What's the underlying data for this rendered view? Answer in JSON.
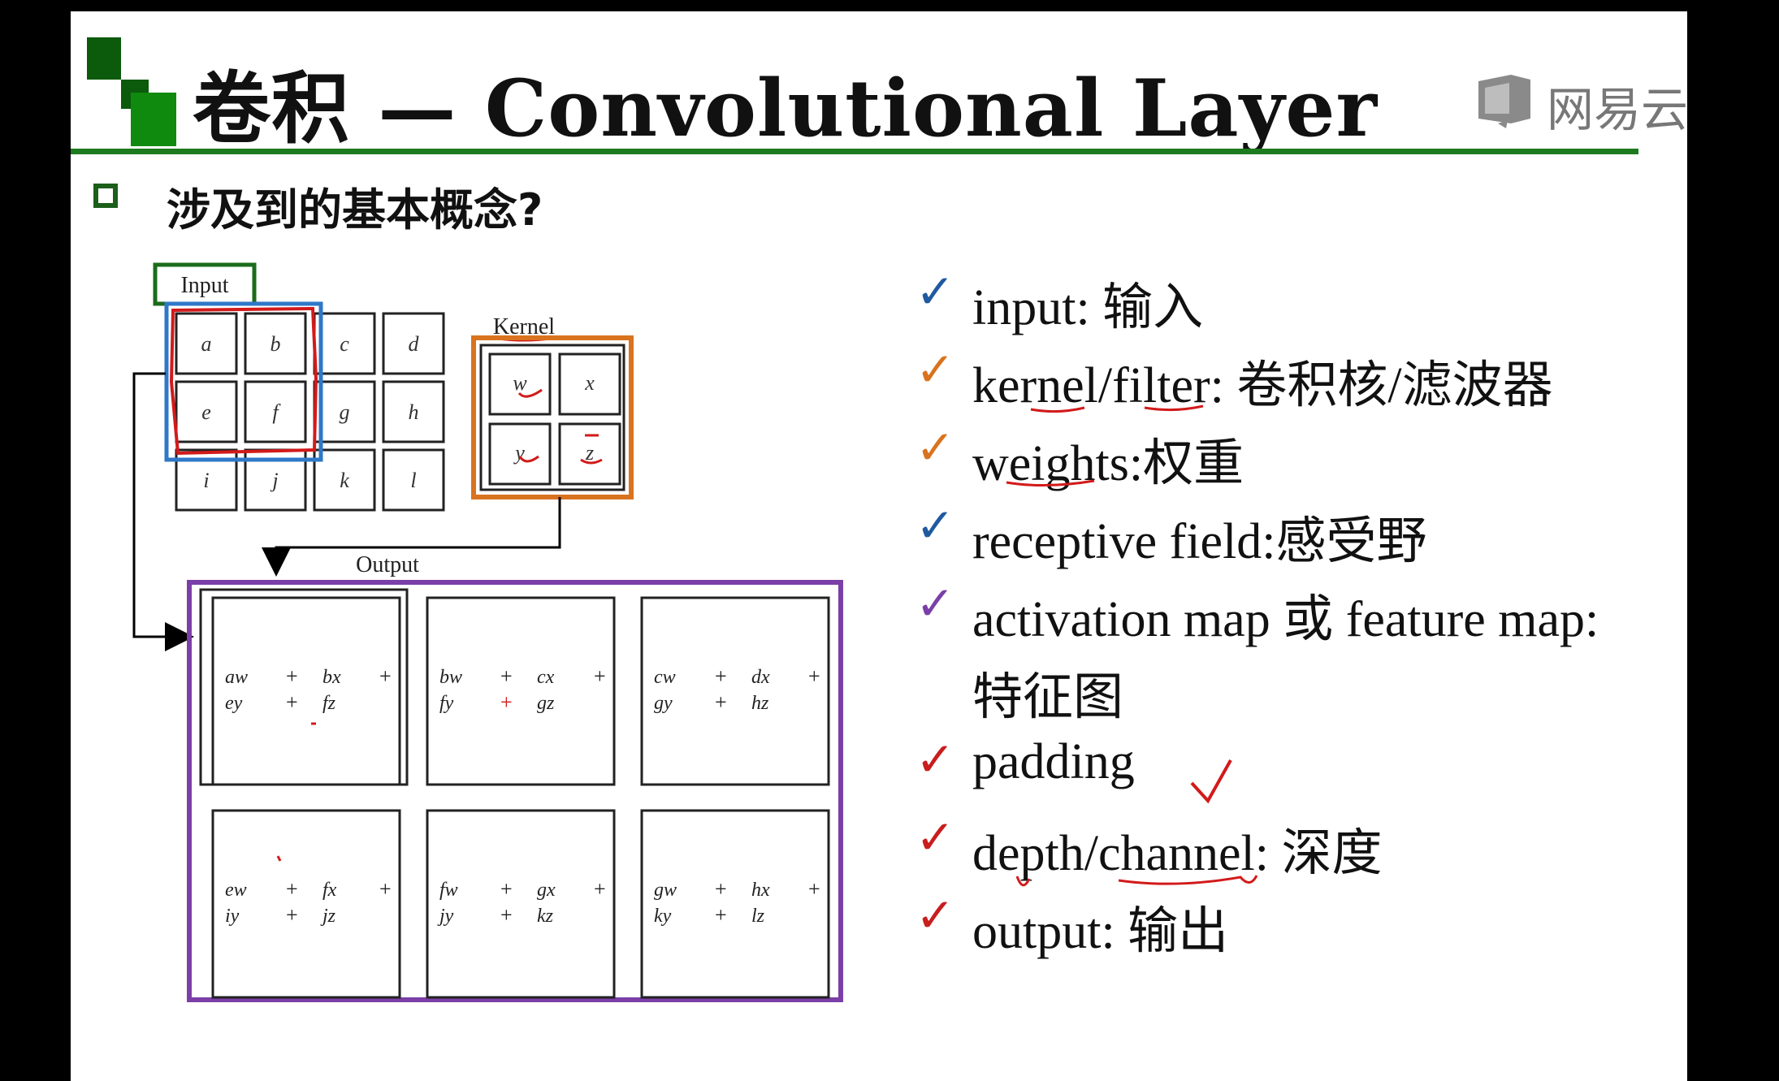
{
  "title": "卷积 — Convolutional Layer",
  "logo": {
    "text": "网易云",
    "icon": "cloud-book-icon"
  },
  "subtitle": "涉及到的基本概念?",
  "colors": {
    "green": "#1e7a1e",
    "blue": "#2f78c8",
    "red": "#d21a1a",
    "orange": "#d9731f",
    "purple": "#7b3fa8"
  },
  "diagram": {
    "input_label": "Input",
    "kernel_label": "Kernel",
    "output_label": "Output",
    "input_grid": [
      "a",
      "b",
      "c",
      "d",
      "e",
      "f",
      "g",
      "h",
      "i",
      "j",
      "k",
      "l"
    ],
    "kernel_grid": [
      "w",
      "x",
      "y",
      "z"
    ],
    "output_cells": [
      {
        "t1": "aw",
        "t2": "bx",
        "b1": "ey",
        "b2": "fz"
      },
      {
        "t1": "bw",
        "t2": "cx",
        "b1": "fy",
        "b2": "gz"
      },
      {
        "t1": "cw",
        "t2": "dx",
        "b1": "gy",
        "b2": "hz"
      },
      {
        "t1": "ew",
        "t2": "fx",
        "b1": "iy",
        "b2": "jz"
      },
      {
        "t1": "fw",
        "t2": "gx",
        "b1": "jy",
        "b2": "kz"
      },
      {
        "t1": "gw",
        "t2": "hx",
        "b1": "ky",
        "b2": "lz"
      }
    ],
    "plus": "+"
  },
  "concepts": [
    {
      "check_color": "#1f5aa0",
      "label": "input: 输入"
    },
    {
      "check_color": "#d9731f",
      "label": "kernel/filter: 卷积核/滤波器"
    },
    {
      "check_color": "#d9731f",
      "label": "weights:权重"
    },
    {
      "check_color": "#1f5aa0",
      "label": "receptive field:感受野"
    },
    {
      "check_color": "#7b3fa8",
      "label": "activation map 或 feature map:"
    },
    {
      "check_color": "",
      "label": "特征图"
    },
    {
      "check_color": "#c81e1e",
      "label": "padding"
    },
    {
      "check_color": "#c81e1e",
      "label": "depth/channel: 深度"
    },
    {
      "check_color": "#c81e1e",
      "label": "output: 输出"
    }
  ],
  "check_glyph": "✓"
}
